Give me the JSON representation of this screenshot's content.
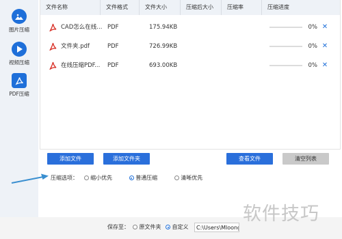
{
  "sidebar": {
    "items": [
      {
        "label": "图片压缩",
        "icon": "image-icon"
      },
      {
        "label": "视频压缩",
        "icon": "play-icon"
      },
      {
        "label": "PDF压缩",
        "icon": "pdf-acrobat-icon",
        "active": true
      }
    ]
  },
  "table": {
    "headers": [
      "文件名称",
      "文件格式",
      "文件大小",
      "压缩后大小",
      "压缩率",
      "压缩进度"
    ],
    "rows": [
      {
        "name": "CAD怎么在线...",
        "format": "PDF",
        "size": "175.94KB",
        "compressed_size": "",
        "ratio": "",
        "progress": "0%",
        "progress_value": 0
      },
      {
        "name": "文件夹.pdf",
        "format": "PDF",
        "size": "726.99KB",
        "compressed_size": "",
        "ratio": "",
        "progress": "0%",
        "progress_value": 0
      },
      {
        "name": "在线压缩PDF...",
        "format": "PDF",
        "size": "693.00KB",
        "compressed_size": "",
        "ratio": "",
        "progress": "0%",
        "progress_value": 0
      }
    ]
  },
  "buttons": {
    "add_file": "添加文件",
    "add_folder": "添加文件夹",
    "view_file": "查看文件",
    "clear_list": "清空列表"
  },
  "compress_options": {
    "label": "压缩选项：",
    "options": [
      "缩小优先",
      "普通压缩",
      "清晰优先"
    ],
    "selected": "普通压缩"
  },
  "save": {
    "label": "保存至：",
    "options": [
      "原文件夹",
      "自定义"
    ],
    "selected": "自定义",
    "path": "C:\\Users\\Mloong"
  },
  "watermark": "软件技巧",
  "colors": {
    "accent": "#1e6fd9",
    "button_blue": "#2a6fdb",
    "button_gray": "#c9c9c9",
    "sidebar_bg": "#eef2f7",
    "pdf_red": "#d9342b",
    "arrow": "#3a8fd0"
  }
}
